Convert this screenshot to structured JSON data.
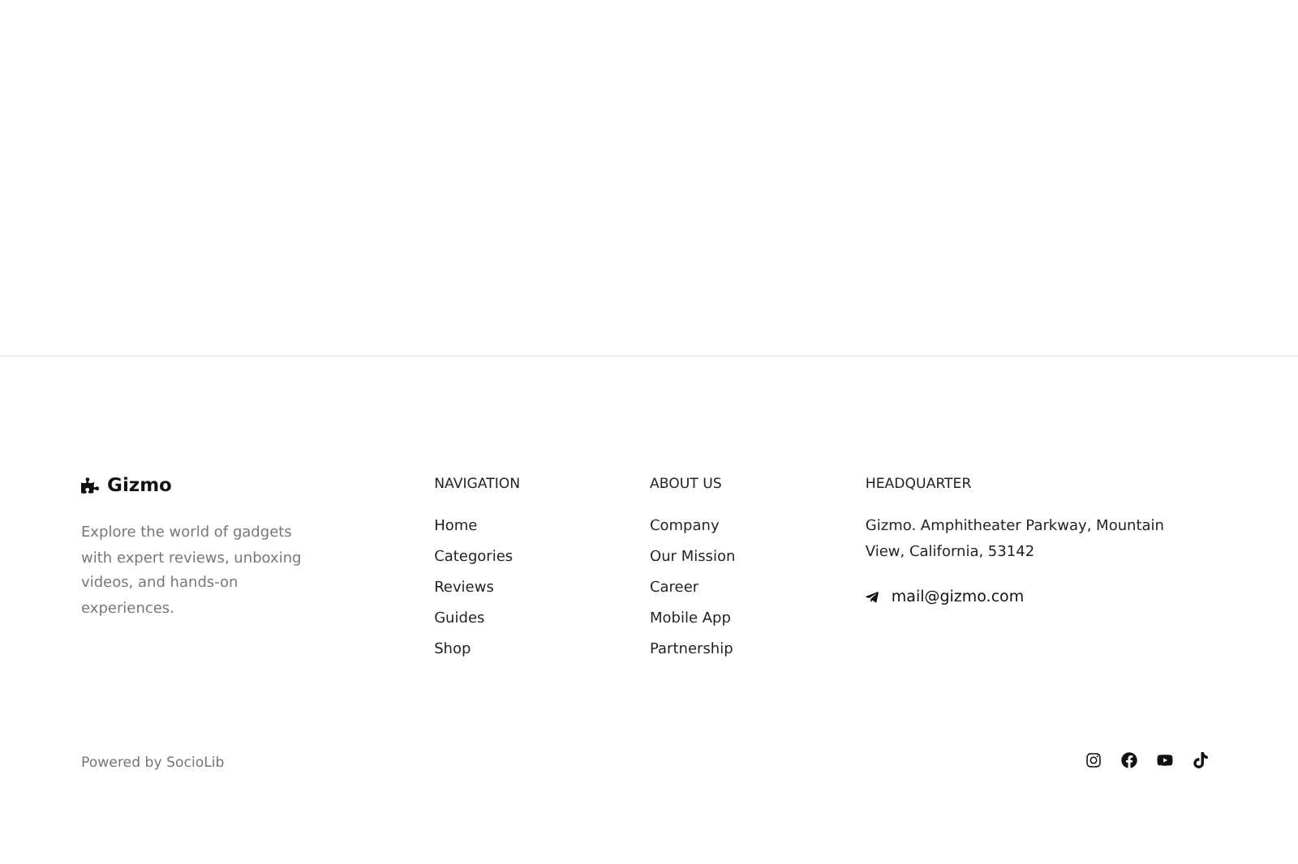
{
  "brand": {
    "name": "Gizmo",
    "description": "Explore the world of gadgets with expert reviews, unboxing videos, and hands-on experiences."
  },
  "columns": [
    {
      "title": "NAVIGATION",
      "links": [
        "Home",
        "Categories",
        "Reviews",
        "Guides",
        "Shop"
      ]
    },
    {
      "title": "ABOUT US",
      "links": [
        "Company",
        "Our Mission",
        "Career",
        "Mobile App",
        "Partnership"
      ]
    }
  ],
  "headquarter": {
    "title": "HEADQUARTER",
    "address": "Gizmo. Amphitheater Parkway, Mountain View, California, 53142",
    "email": "mail@gizmo.com"
  },
  "powered_by": "Powered by SocioLib",
  "socials": [
    {
      "kind": "instagram"
    },
    {
      "kind": "facebook"
    },
    {
      "kind": "youtube"
    },
    {
      "kind": "tiktok"
    }
  ]
}
